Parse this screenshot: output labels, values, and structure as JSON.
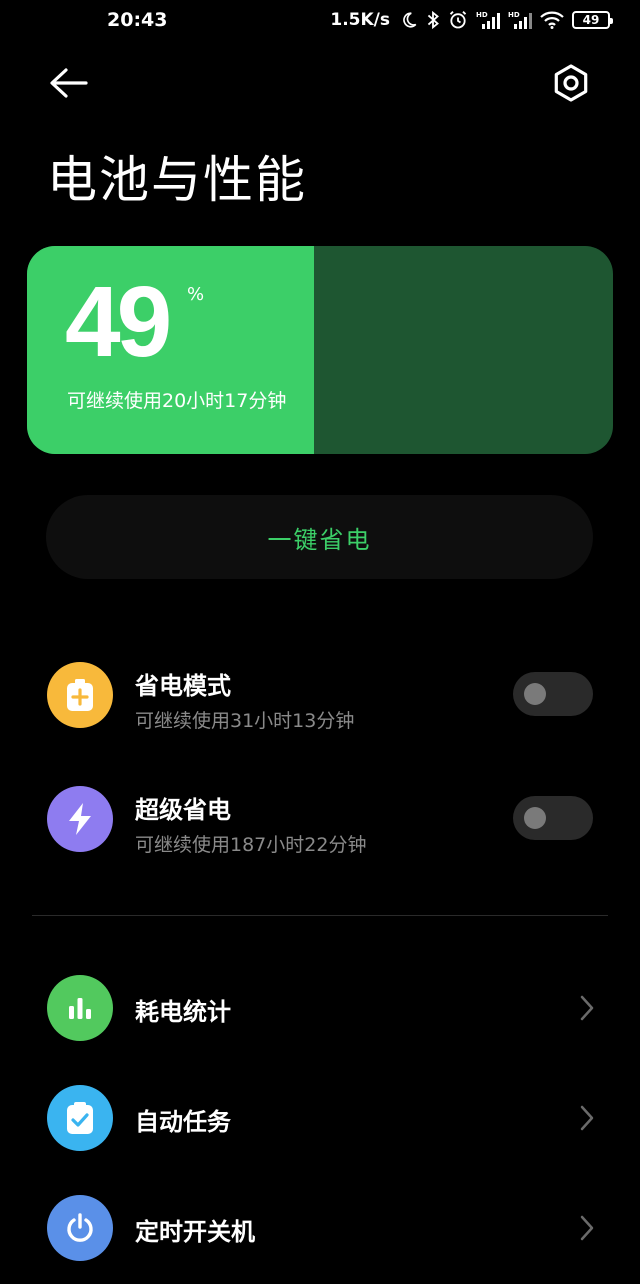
{
  "status_bar": {
    "time": "20:43",
    "net_speed": "1.5K/s",
    "battery_level": "49",
    "icons": [
      "moon-icon",
      "bluetooth-icon",
      "alarm-icon",
      "signal-hd-icon",
      "signal-hd-icon",
      "wifi-icon",
      "battery-icon"
    ]
  },
  "header": {
    "back_icon": "arrow-left-icon",
    "settings_icon": "hexagon-gear-icon",
    "title": "电池与性能"
  },
  "battery": {
    "percent": "49",
    "percent_sign": "%",
    "level_fraction": 0.49,
    "remaining": "可继续使用20小时17分钟",
    "fill_color": "#3ccf68",
    "empty_color": "#1e5631"
  },
  "one_tap": {
    "label": "一键省电",
    "color": "#3ccf68"
  },
  "modes": [
    {
      "title": "省电模式",
      "subtitle": "可继续使用31小时13分钟",
      "icon": "battery-plus-icon",
      "icon_color": "#f8b93b",
      "enabled": false
    },
    {
      "title": "超级省电",
      "subtitle": "可继续使用187小时22分钟",
      "icon": "lightning-icon",
      "icon_color": "#8e7cf0",
      "enabled": false
    }
  ],
  "links": [
    {
      "title": "耗电统计",
      "icon": "bar-chart-icon",
      "icon_color": "#52c95e"
    },
    {
      "title": "自动任务",
      "icon": "clipboard-check-icon",
      "icon_color": "#3ab4f0"
    },
    {
      "title": "定时开关机",
      "icon": "power-icon",
      "icon_color": "#5a90e8"
    }
  ]
}
